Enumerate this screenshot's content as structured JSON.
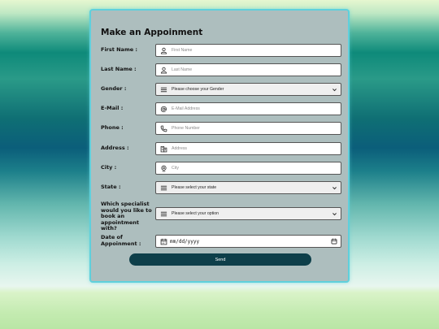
{
  "form": {
    "title": "Make an Appoinment",
    "first_name": {
      "label": "First Name :",
      "placeholder": "First Name"
    },
    "last_name": {
      "label": "Last Name :",
      "placeholder": "Last Name"
    },
    "gender": {
      "label": "Gender :",
      "selected": "Please choose your Gender"
    },
    "email": {
      "label": "E-Mail :",
      "placeholder": "E-Mail Address"
    },
    "phone": {
      "label": "Phone :",
      "placeholder": "Phone Number"
    },
    "address": {
      "label": "Address :",
      "placeholder": "Address"
    },
    "city": {
      "label": "City :",
      "placeholder": "City"
    },
    "state": {
      "label": "State :",
      "selected": "Please select your state"
    },
    "specialist": {
      "label": "Which specialist would you like to book an appointment with?",
      "selected": "Please select your option"
    },
    "date": {
      "label": "Date of Appoinment :",
      "value": "mm/dd/yyyy"
    },
    "send_label": "Send"
  },
  "icons": {
    "first_name": "user-icon",
    "last_name": "user-icon",
    "gender": "list-icon",
    "email": "at-icon",
    "phone": "phone-icon",
    "address": "building-icon",
    "city": "location-pin-icon",
    "state": "list-icon",
    "specialist": "list-icon",
    "date": "calendar-icon"
  },
  "colors": {
    "card_background": "#adbebe",
    "card_border": "#5fd0dc",
    "button_background": "#0e3f4a",
    "button_text": "#ffffff"
  }
}
